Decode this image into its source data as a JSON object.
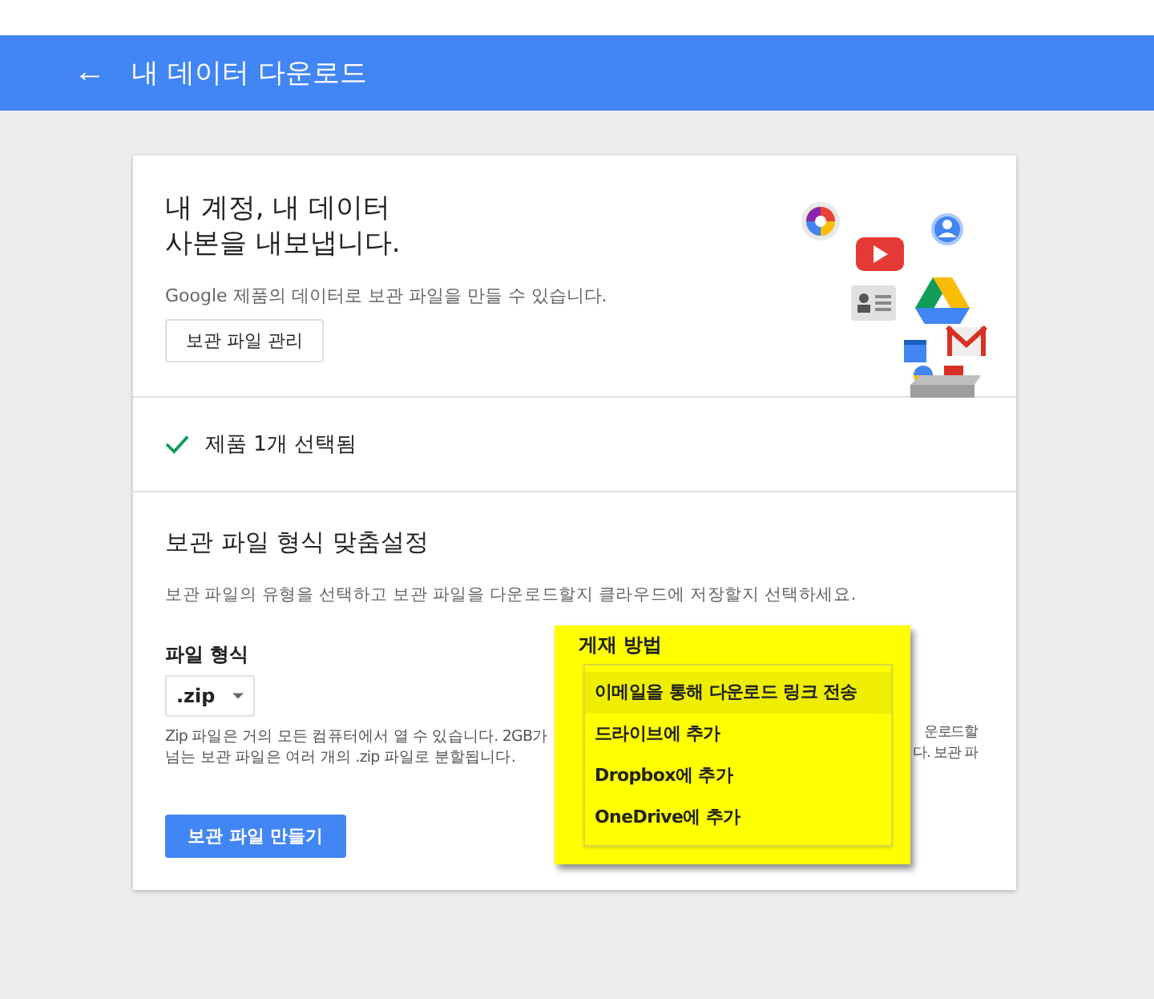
{
  "header": {
    "back": "←",
    "title": "내 데이터 다운로드"
  },
  "intro": {
    "heading_lines": [
      "내 계정, 내 데이터",
      "사본을 내보냅니다."
    ],
    "description": "Google 제품의 데이터로 보관 파일을 만들 수 있습니다.",
    "manage_button": "보관 파일 관리"
  },
  "selection": {
    "summary": "제품 1개 선택됨"
  },
  "customize": {
    "heading": "보관 파일 형식 맞춤설정",
    "description": "보관 파일의 유형을 선택하고 보관 파일을 다운로드할지 클라우드에 저장할지 선택하세요.",
    "file_type": {
      "label": "파일 형식",
      "value": ".zip",
      "help_lines": [
        "Zip 파일은 거의 모든 컴퓨터에서 열 수 있습니다. 2GB가",
        "넘는 보관 파일은 여러 개의 .zip 파일로 분할됩니다."
      ]
    },
    "delivery": {
      "label": "게재 방법",
      "help_fragments": [
        "운로드할",
        "다. 보관 파"
      ],
      "options": [
        {
          "label": "이메일을 통해 다운로드 링크 전송",
          "selected": true
        },
        {
          "label": "드라이브에 추가",
          "selected": false
        },
        {
          "label": "Dropbox에 추가",
          "selected": false
        },
        {
          "label": "OneDrive에 추가",
          "selected": false
        }
      ]
    },
    "create_button": "보관 파일 만들기"
  }
}
